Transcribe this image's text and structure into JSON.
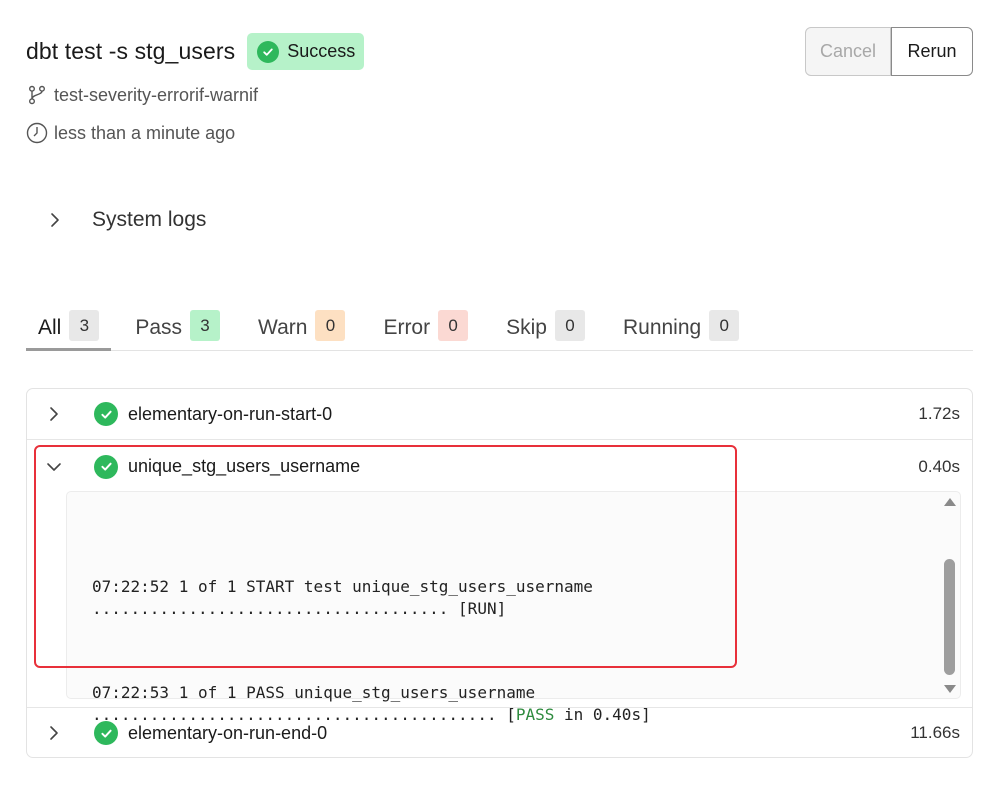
{
  "header": {
    "title": "dbt test -s stg_users",
    "status_label": "Success",
    "branch": "test-severity-errorif-warnif",
    "time_ago": "less than a minute ago",
    "branch_icon": "git-branch-icon",
    "clock_icon": "clock-icon"
  },
  "actions": {
    "cancel_label": "Cancel",
    "rerun_label": "Rerun"
  },
  "system_logs": {
    "label": "System logs"
  },
  "tabs": [
    {
      "label": "All",
      "count": "3",
      "count_bg": "#e8e8e8"
    },
    {
      "label": "Pass",
      "count": "3",
      "count_bg": "#b6f2c9"
    },
    {
      "label": "Warn",
      "count": "0",
      "count_bg": "#fde0c2"
    },
    {
      "label": "Error",
      "count": "0",
      "count_bg": "#fbd9d3"
    },
    {
      "label": "Skip",
      "count": "0",
      "count_bg": "#e8e8e8"
    },
    {
      "label": "Running",
      "count": "0",
      "count_bg": "#e8e8e8"
    }
  ],
  "results": [
    {
      "name": "elementary-on-run-start-0",
      "duration": "1.72s",
      "status": "pass",
      "expanded": false
    },
    {
      "name": "unique_stg_users_username",
      "duration": "0.40s",
      "status": "pass",
      "expanded": true
    },
    {
      "name": "elementary-on-run-end-0",
      "duration": "11.66s",
      "status": "pass",
      "expanded": false
    }
  ],
  "log": {
    "line1": "07:22:52 1 of 1 START test unique_stg_users_username",
    "line2": "..................................... [RUN]",
    "line3": "07:22:53 1 of 1 PASS unique_stg_users_username",
    "line4_prefix": ".......................................... [",
    "line4_status": "PASS",
    "line4_suffix": " in 0.40s]"
  },
  "colors": {
    "success": "#2eb85c",
    "success_bg": "#b6f2c9",
    "highlight": "#e8303a"
  }
}
